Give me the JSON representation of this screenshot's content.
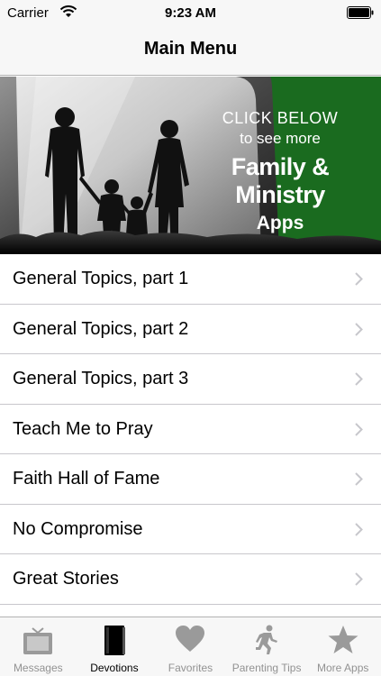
{
  "status_bar": {
    "carrier": "Carrier",
    "time": "9:23 AM"
  },
  "nav": {
    "title": "Main Menu"
  },
  "banner": {
    "line1": "CLICK BELOW",
    "line2": "to see more",
    "line3": "Family & Ministry",
    "line4": "Apps",
    "background_color": "#1a6b1f"
  },
  "menu": {
    "items": [
      {
        "label": "General Topics, part 1"
      },
      {
        "label": "General Topics, part 2"
      },
      {
        "label": "General Topics, part 3"
      },
      {
        "label": "Teach Me to Pray"
      },
      {
        "label": "Faith Hall of Fame"
      },
      {
        "label": "No Compromise"
      },
      {
        "label": "Great Stories"
      }
    ]
  },
  "tabs": [
    {
      "label": "Messages",
      "icon": "tv-icon"
    },
    {
      "label": "Devotions",
      "icon": "book-icon",
      "active": true
    },
    {
      "label": "Favorites",
      "icon": "heart-icon"
    },
    {
      "label": "Parenting Tips",
      "icon": "runner-icon"
    },
    {
      "label": "More Apps",
      "icon": "star-icon"
    }
  ]
}
